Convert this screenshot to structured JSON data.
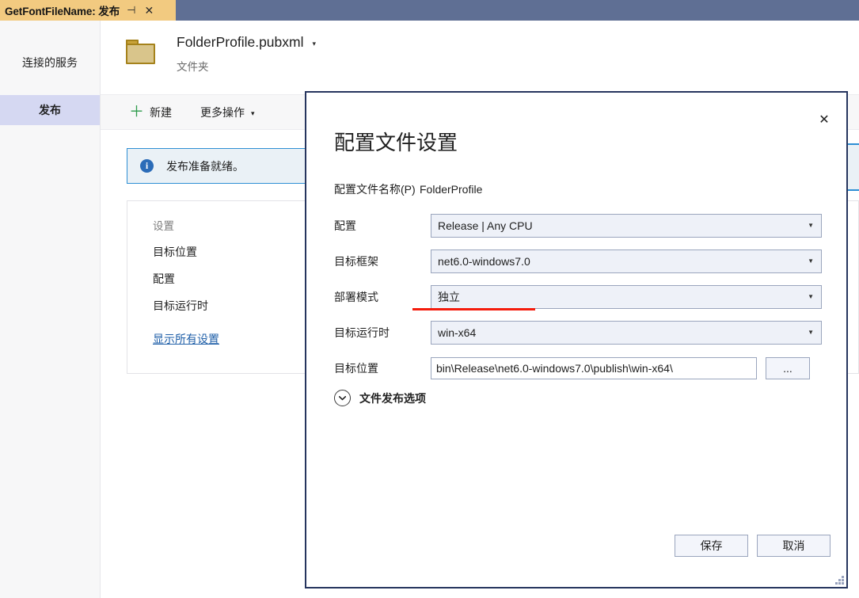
{
  "tab": {
    "title": "GetFontFileName: 发布",
    "pin_icon": "pin-icon",
    "close_icon": "close-icon"
  },
  "sidebar": {
    "items": [
      {
        "label": "连接的服务",
        "selected": false
      },
      {
        "label": "发布",
        "selected": true
      }
    ]
  },
  "profile_header": {
    "icon": "folder-icon",
    "name": "FolderProfile.pubxml",
    "caret": "▾",
    "subtitle": "文件夹"
  },
  "toolbar": {
    "new_label": "新建",
    "new_plus": "＋",
    "more_label": "更多操作",
    "more_caret": "▾"
  },
  "info_banner": {
    "icon_glyph": "i",
    "text": "发布准备就绪。"
  },
  "settings_card": {
    "title": "设置",
    "rows": [
      {
        "label": "目标位置"
      },
      {
        "label": "配置"
      },
      {
        "label": "目标运行时"
      }
    ],
    "link": "显示所有设置"
  },
  "dialog": {
    "close_icon": "✕",
    "title": "配置文件设置",
    "profile_name_label": "配置文件名称(P)",
    "profile_name_value": "FolderProfile",
    "fields": [
      {
        "label": "配置",
        "value": "Release | Any CPU",
        "caret": "▼"
      },
      {
        "label": "目标框架",
        "value": "net6.0-windows7.0",
        "caret": "▼"
      },
      {
        "label": "部署模式",
        "value": "独立",
        "caret": "▼"
      },
      {
        "label": "目标运行时",
        "value": "win-x64",
        "caret": "▼"
      }
    ],
    "location": {
      "label": "目标位置",
      "value": "bin\\Release\\net6.0-windows7.0\\publish\\win-x64\\",
      "browse_label": "..."
    },
    "expander": {
      "caret": "❯",
      "label": "文件发布选项"
    },
    "save_label": "保存",
    "cancel_label": "取消"
  },
  "colors": {
    "tab_active": "#f2ca80",
    "tab_strip": "#5f6f94",
    "nav_selected": "#d5d8f2",
    "accent_blue": "#2e8fd4",
    "link_blue": "#1f5fa8",
    "annotation_red": "#f41c0c",
    "dialog_border": "#26355e",
    "combo_bg": "#eef1f8",
    "plus_green": "#2d9b4b"
  }
}
